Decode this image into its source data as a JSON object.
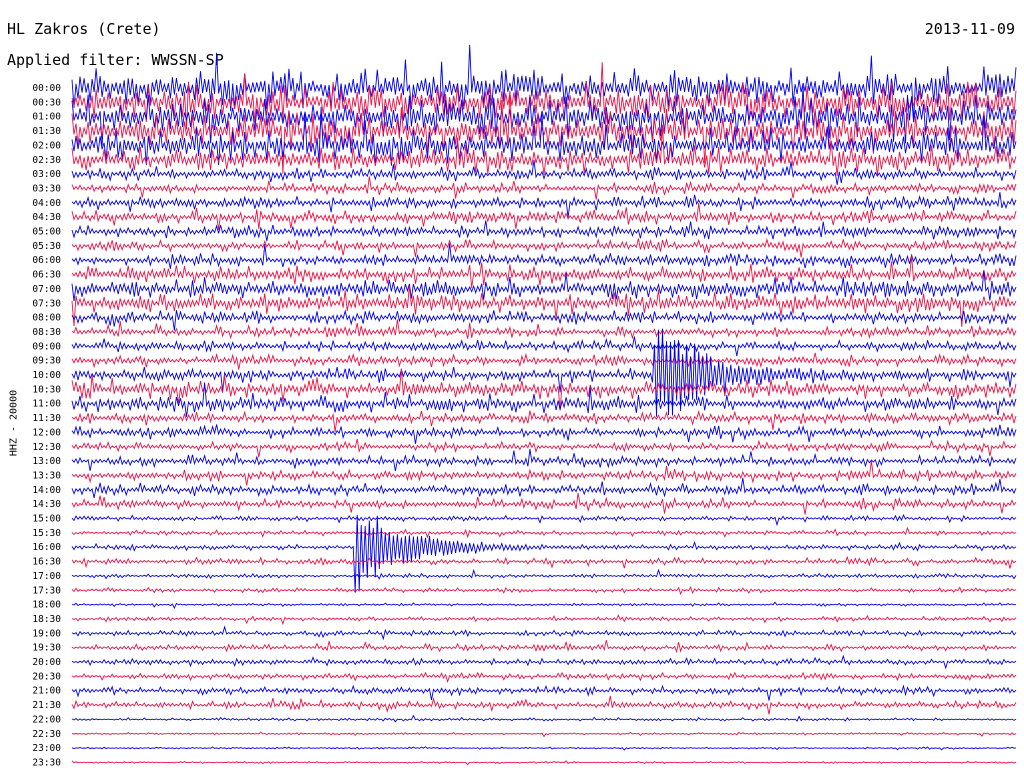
{
  "header": {
    "station": "HL Zakros (Crete)",
    "date": "2013-11-09",
    "filter": "Applied filter: WWSSN-SP"
  },
  "chart_data": {
    "type": "line",
    "ylabel": "HHZ - 20000",
    "row_labels": [
      "00:00",
      "00:30",
      "01:00",
      "01:30",
      "02:00",
      "02:30",
      "03:00",
      "03:30",
      "04:00",
      "04:30",
      "05:00",
      "05:30",
      "06:00",
      "06:30",
      "07:00",
      "07:30",
      "08:00",
      "08:30",
      "09:00",
      "09:30",
      "10:00",
      "10:30",
      "11:00",
      "11:30",
      "12:00",
      "12:30",
      "13:00",
      "13:30",
      "14:00",
      "14:30",
      "15:00",
      "15:30",
      "16:00",
      "16:30",
      "17:00",
      "17:30",
      "18:00",
      "18:30",
      "19:00",
      "19:30",
      "20:00",
      "20:30",
      "21:00",
      "21:30",
      "22:00",
      "22:30",
      "23:00",
      "23:30"
    ],
    "colors": [
      "#0000ee",
      "#ee1144"
    ],
    "noise_level": [
      1.0,
      1.0,
      1.0,
      1.0,
      0.9,
      0.7,
      0.35,
      0.3,
      0.35,
      0.35,
      0.35,
      0.3,
      0.35,
      0.45,
      0.55,
      0.55,
      0.35,
      0.3,
      0.3,
      0.3,
      0.35,
      0.45,
      0.45,
      0.3,
      0.3,
      0.25,
      0.28,
      0.3,
      0.3,
      0.28,
      0.15,
      0.12,
      0.15,
      0.18,
      0.12,
      0.12,
      0.08,
      0.12,
      0.15,
      0.18,
      0.18,
      0.18,
      0.2,
      0.2,
      0.08,
      0.06,
      0.05,
      0.05
    ],
    "events": [
      {
        "row": 20,
        "start_fraction": 0.615,
        "amplitude": 2.5
      },
      {
        "row": 32,
        "start_fraction": 0.3,
        "amplitude": 2.0
      }
    ]
  }
}
